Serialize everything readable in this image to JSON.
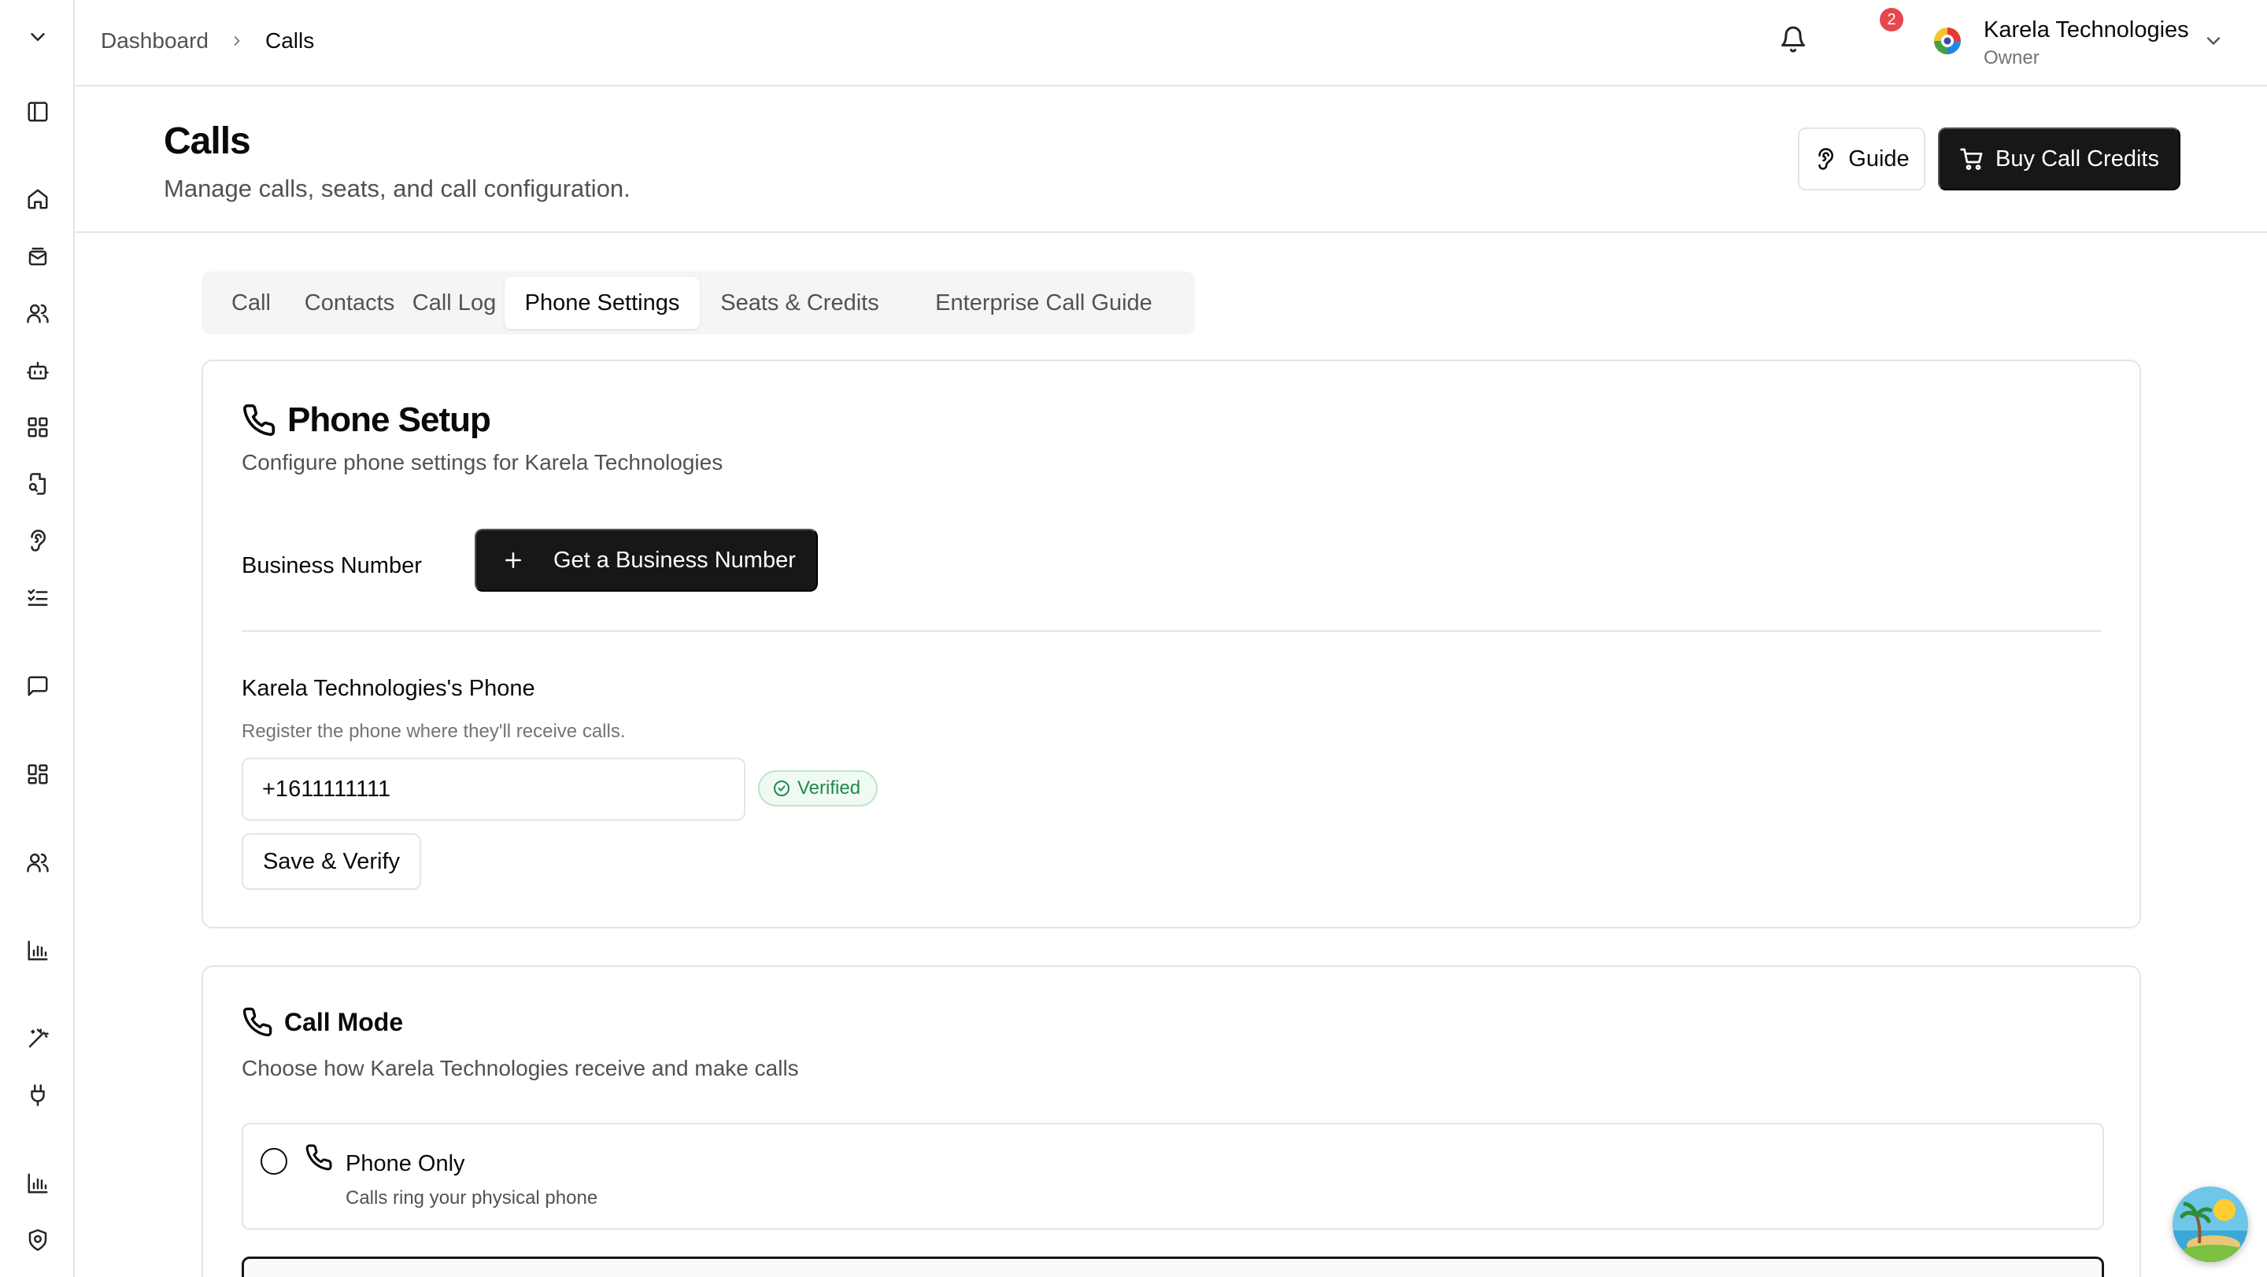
{
  "breadcrumb": {
    "parent": "Dashboard",
    "current": "Calls"
  },
  "notifications": {
    "count": "2"
  },
  "org": {
    "name": "Karela Technologies",
    "role": "Owner"
  },
  "header": {
    "title": "Calls",
    "subtitle": "Manage calls, seats, and call configuration.",
    "guide_label": "Guide",
    "buy_label": "Buy Call Credits"
  },
  "tabs": [
    {
      "label": "Call"
    },
    {
      "label": "Contacts"
    },
    {
      "label": "Call Log"
    },
    {
      "label": "Phone Settings",
      "active": true
    },
    {
      "label": "Seats & Credits"
    },
    {
      "label": "Enterprise Call Guide"
    }
  ],
  "phone_setup": {
    "title": "Phone Setup",
    "description": "Configure phone settings for Karela Technologies",
    "business_number_label": "Business Number",
    "get_number_label": "Get a Business Number",
    "phone_title": "Karela Technologies's Phone",
    "phone_hint": "Register the phone where they'll receive calls.",
    "phone_value": "+1611111111",
    "verified_label": "Verified",
    "save_label": "Save & Verify"
  },
  "call_mode": {
    "title": "Call Mode",
    "description": "Choose how Karela Technologies receive and make calls",
    "options": [
      {
        "title": "Phone Only",
        "description": "Calls ring your physical phone"
      }
    ]
  },
  "colors": {
    "primary": "#171717",
    "badge": "#e5484d",
    "verified": "#1f8a4c",
    "border": "#e5e5e5"
  }
}
